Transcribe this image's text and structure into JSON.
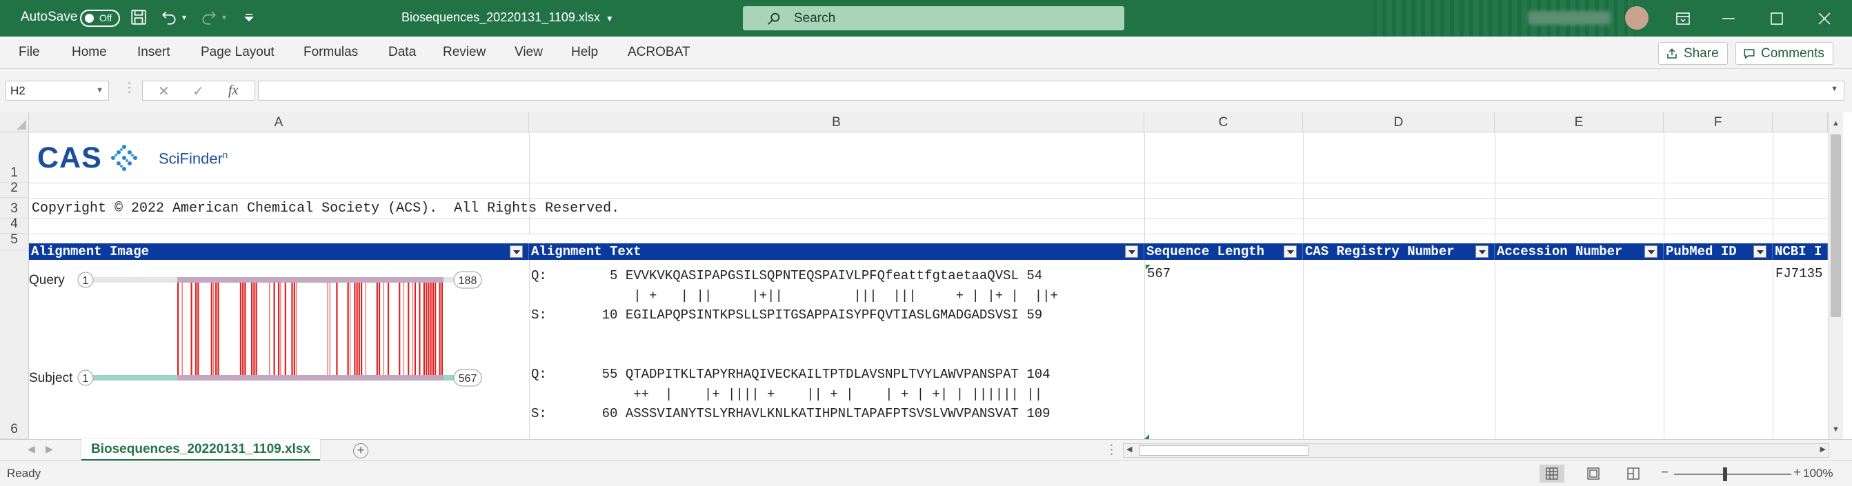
{
  "titlebar": {
    "autosave_label": "AutoSave",
    "autosave_state": "Off",
    "document_name": "Biosequences_20220131_1109.xlsx",
    "search_placeholder": "Search"
  },
  "ribbon": {
    "tabs": [
      "File",
      "Home",
      "Insert",
      "Page Layout",
      "Formulas",
      "Data",
      "Review",
      "View",
      "Help",
      "ACROBAT"
    ],
    "share_label": "Share",
    "comments_label": "Comments"
  },
  "formula_bar": {
    "name_box": "H2",
    "fx_label": "fx",
    "formula": ""
  },
  "grid": {
    "columns": [
      "A",
      "B",
      "C",
      "D",
      "E",
      "F"
    ],
    "rows": [
      "1",
      "2",
      "3",
      "4",
      "5",
      "6"
    ],
    "logo_text": "CAS",
    "logo_product": "SciFinder",
    "logo_superscript": "n",
    "copyright": "Copyright © 2022 American Chemical Society (ACS).  All Rights Reserved.",
    "headers": [
      "Alignment Image",
      "Alignment Text",
      "Sequence Length",
      "CAS Registry Number",
      "Accession Number",
      "PubMed ID",
      "NCBI I"
    ],
    "alignment_image": {
      "query_label": "Query",
      "subject_label": "Subject",
      "query_start": "1",
      "query_end": "188",
      "subject_start": "1",
      "subject_end": "567",
      "colors": {
        "match": "#e02020",
        "query_track": "#e6e6e6",
        "subject_track": "#9fd3c7",
        "region": "#c4a7c0"
      }
    },
    "alignment_text": [
      "Q:        5 EVVKVKQASIPAPGSILSQPNTEQSPAIVLPFQfeattfgtaetaaQVSL 54",
      "             | +   | ||     |+||         |||  |||     + | |+ |  ||+",
      "S:       10 EGILAPQPSINTKPSLLSPITGSAPPAISYPFQVTIASLGMADGADSVSI 59",
      "",
      "",
      "Q:       55 QTADPITKLTAPYRHAQIVECKAILTPTDLAVSNPLTVYLAWVPANSPAT 104",
      "             ++  |    |+ |||| +    || + |    | + | +| | |||||| ||",
      "S:       60 ASSSVIANYTSLYRHAVLKNLKATIHPNLTAPAFPTSVSLVWVPANSVAT 109"
    ],
    "sequence_length": "567",
    "ncbi_value": "FJ7135"
  },
  "sheet_tab": "Biosequences_20220131_1109.xlsx",
  "status": {
    "ready": "Ready",
    "zoom": "100%"
  }
}
